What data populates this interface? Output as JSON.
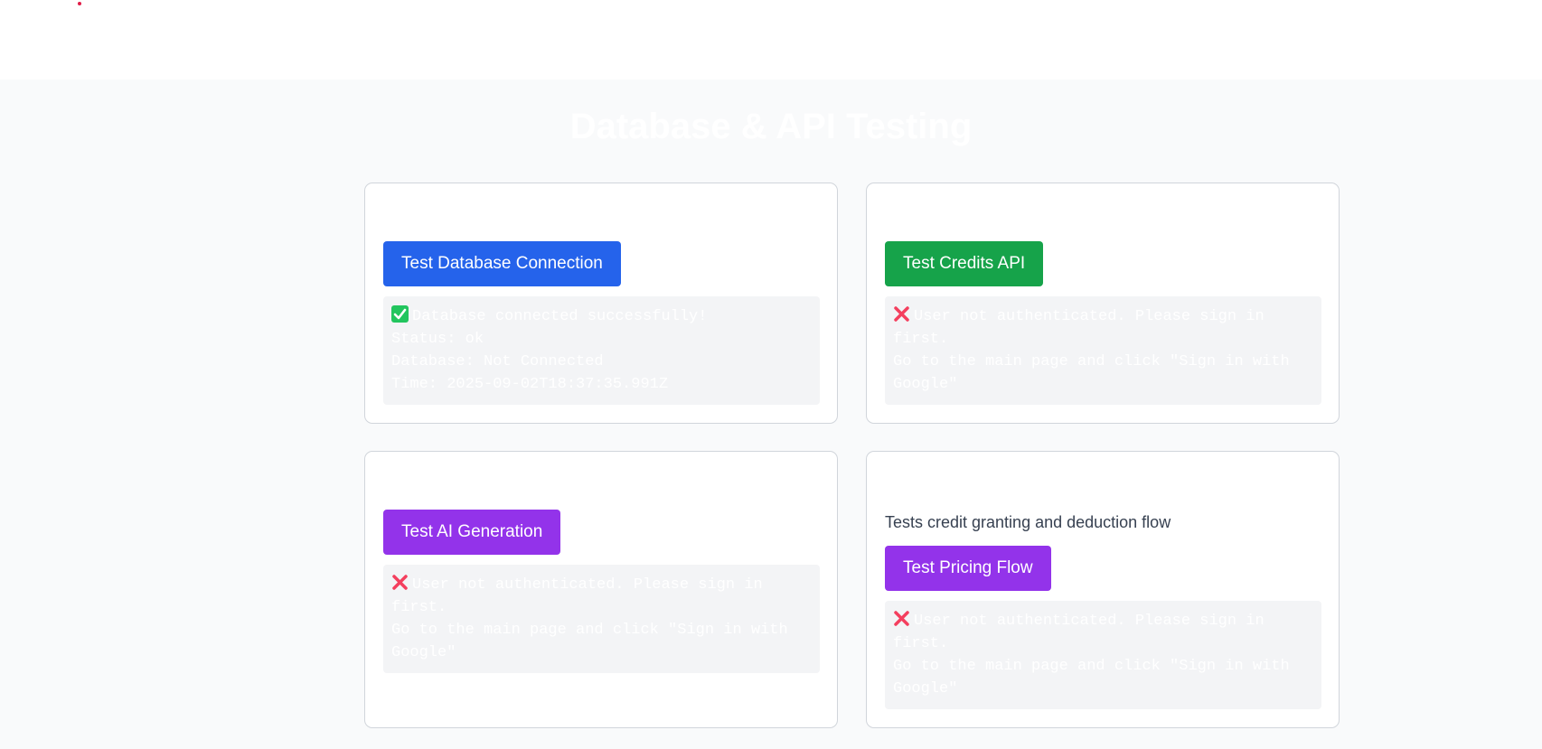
{
  "page": {
    "title": "Database & API Testing"
  },
  "cards": [
    {
      "title": "",
      "description": "",
      "button_label": "Test Database Connection",
      "result_icon": "check-icon",
      "result_lines": [
        "Database connected successfully!",
        "Status: ok",
        "Database: Not Connected",
        "Time: 2025-09-02T18:37:35.991Z"
      ]
    },
    {
      "title": "",
      "description": "",
      "button_label": "Test Credits API",
      "result_icon": "cross-icon",
      "result_lines": [
        "User not authenticated. Please sign in first.",
        "Go to the main page and click \"Sign in with Google\""
      ]
    },
    {
      "title": "",
      "description": "",
      "button_label": "Test AI Generation",
      "result_icon": "cross-icon",
      "result_lines": [
        "User not authenticated. Please sign in first.",
        "Go to the main page and click \"Sign in with Google\""
      ]
    },
    {
      "title": "",
      "description": "Tests credit granting and deduction flow",
      "button_label": "Test Pricing Flow",
      "result_icon": "cross-icon",
      "result_lines": [
        "User not authenticated. Please sign in first.",
        "Go to the main page and click \"Sign in with Google\""
      ]
    }
  ],
  "colors": {
    "blue_button": "#2563eb",
    "green_button": "#16a34a",
    "purple_button": "#9333ea",
    "success": "#22c55e",
    "error": "#f43f5e"
  }
}
